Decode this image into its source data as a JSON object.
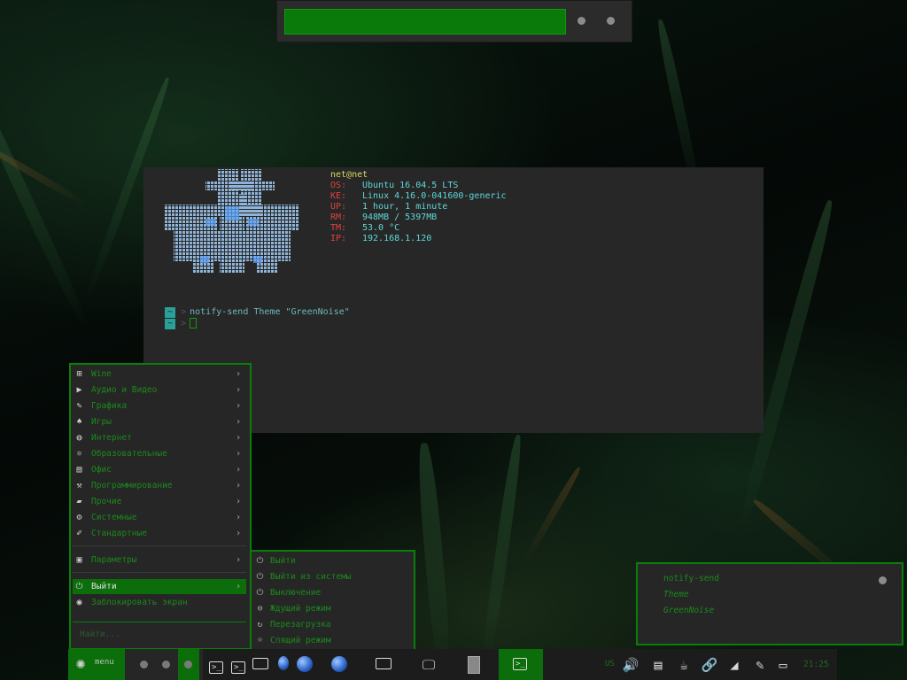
{
  "topbar": {
    "progress_percent": 100
  },
  "terminal": {
    "user_host": "net@net",
    "info": [
      {
        "key": "OS:",
        "value": "Ubuntu 16.04.5 LTS"
      },
      {
        "key": "KE:",
        "value": "Linux 4.16.0-041600-generic"
      },
      {
        "key": "UP:",
        "value": "1 hour, 1 minute"
      },
      {
        "key": "RM:",
        "value": "948MB / 5397MB"
      },
      {
        "key": "TM:",
        "value": "53.0 °C"
      },
      {
        "key": "IP:",
        "value": "192.168.1.120"
      }
    ],
    "prompt_tag": "~",
    "prompt_arrow": ">",
    "command": "notify-send Theme \"GreenNoise\""
  },
  "menu": {
    "categories": [
      {
        "icon": "windows-icon",
        "glyph": "⊞",
        "label": "Wine"
      },
      {
        "icon": "play-icon",
        "glyph": "▶",
        "label": "Аудио и Видео"
      },
      {
        "icon": "palette-icon",
        "glyph": "✎",
        "label": "Графика"
      },
      {
        "icon": "cards-icon",
        "glyph": "♠",
        "label": "Игры"
      },
      {
        "icon": "globe-icon",
        "glyph": "◍",
        "label": "Интернет"
      },
      {
        "icon": "atom-icon",
        "glyph": "⚛",
        "label": "Образовательные"
      },
      {
        "icon": "office-icon",
        "glyph": "▤",
        "label": "Офис"
      },
      {
        "icon": "hammer-icon",
        "glyph": "⚒",
        "label": "Программирование"
      },
      {
        "icon": "bag-icon",
        "glyph": "▰",
        "label": "Прочие"
      },
      {
        "icon": "gear-icon",
        "glyph": "⚙",
        "label": "Системные"
      },
      {
        "icon": "pen-icon",
        "glyph": "✐",
        "label": "Стандартные"
      }
    ],
    "settings": {
      "icon": "settings-icon",
      "glyph": "▣",
      "label": "Параметры"
    },
    "logout": {
      "icon": "power-icon",
      "glyph": "⏻",
      "label": "Выйти"
    },
    "lock": {
      "icon": "lock-icon",
      "glyph": "◉",
      "label": "Заблокировать экран"
    },
    "chevron": "›",
    "search_placeholder": "Найти..."
  },
  "submenu": {
    "items": [
      {
        "icon": "power-icon",
        "glyph": "⏻",
        "label": "Выйти"
      },
      {
        "icon": "power-icon",
        "glyph": "⏻",
        "label": "Выйти из системы"
      },
      {
        "icon": "power-icon",
        "glyph": "⏻",
        "label": "Выключение"
      },
      {
        "icon": "suspend-icon",
        "glyph": "⊖",
        "label": "Ждущий режим"
      },
      {
        "icon": "reboot-icon",
        "glyph": "↻",
        "label": "Перезагрузка"
      },
      {
        "icon": "hibernate-icon",
        "glyph": "☼",
        "label": "Спящий режим"
      }
    ]
  },
  "notification": {
    "title": "notify-send",
    "line1": "Theme",
    "line2": "GreenNoise"
  },
  "panel": {
    "menu_label": "menu",
    "lang": "US",
    "clock": "21:25",
    "accent": "#0b6e0b"
  }
}
